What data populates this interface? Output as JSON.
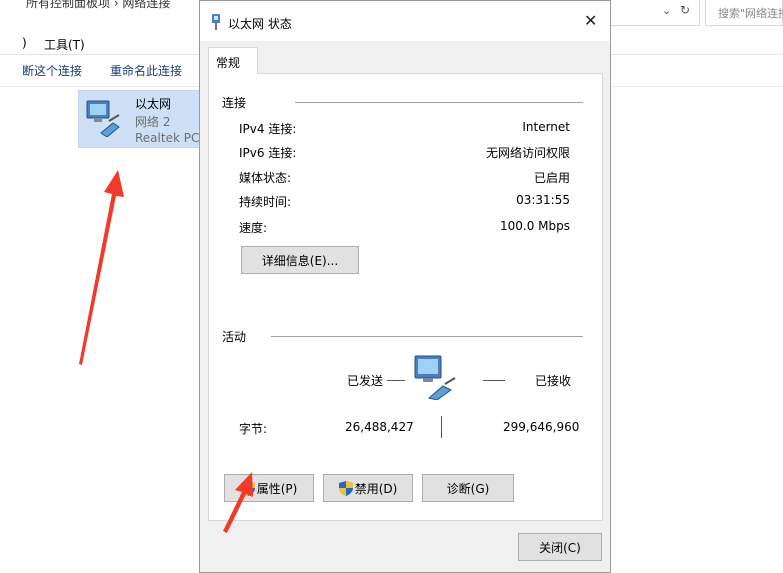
{
  "background_window": {
    "breadcrumb": "所有控制面板项 › 网络连接",
    "search_placeholder": "搜索\"网络连接\"",
    "menu": {
      "paren": ")",
      "tools": "工具(T)"
    },
    "toolbar": {
      "disconnect": "断这个连接",
      "rename": "重命名此连接"
    },
    "network_item": {
      "name": "以太网",
      "network": "网络 2",
      "device": "Realtek PCI"
    }
  },
  "dialog": {
    "title": "以太网 状态",
    "close_glyph": "✕",
    "tab": "常规",
    "connection": {
      "header": "连接",
      "rows": [
        {
          "label": "IPv4 连接:",
          "value": "Internet"
        },
        {
          "label": "IPv6 连接:",
          "value": "无网络访问权限"
        },
        {
          "label": "媒体状态:",
          "value": "已启用"
        },
        {
          "label": "持续时间:",
          "value": "03:31:55"
        },
        {
          "label": "速度:",
          "value": "100.0 Mbps"
        }
      ],
      "details_button": "详细信息(E)..."
    },
    "activity": {
      "header": "活动",
      "sent": "已发送",
      "received": "已接收",
      "bytes_label": "字节:",
      "bytes_sent": "26,488,427",
      "bytes_received": "299,646,960"
    },
    "buttons": {
      "properties": "属性(P)",
      "disable": "禁用(D)",
      "diagnose": "诊断(G)",
      "close": "关闭(C)"
    }
  },
  "colors": {
    "annotation_arrow": "#f03a2a",
    "selection_bg": "#cde0f5",
    "dialog_bg": "#f0f0f0",
    "link_text": "#1a3d78"
  }
}
